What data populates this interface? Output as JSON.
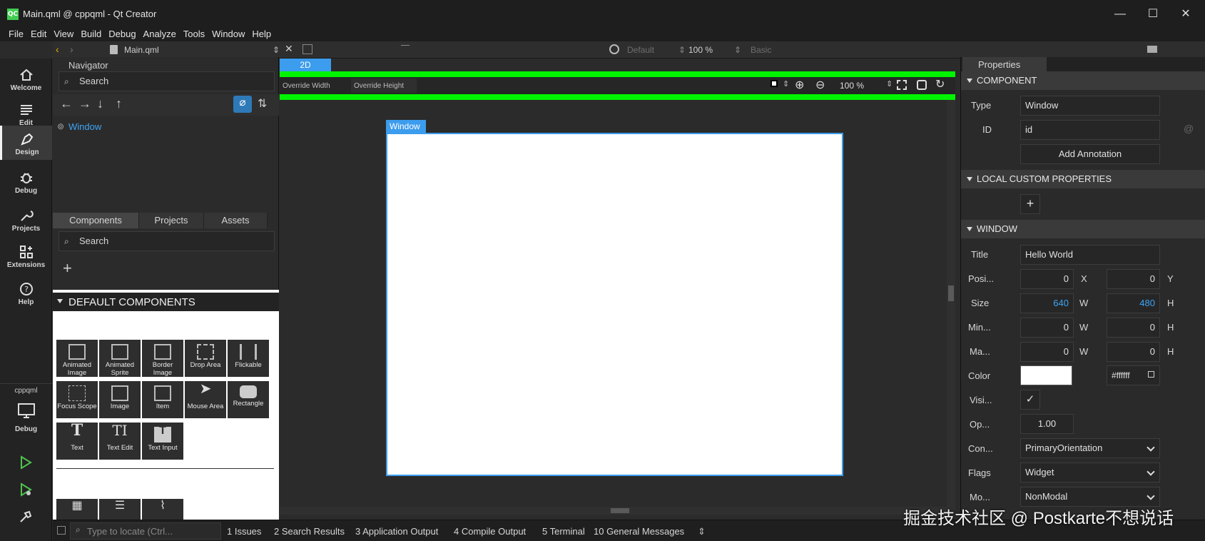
{
  "window": {
    "title": "Main.qml @ cppqml - Qt Creator",
    "logo": "QC"
  },
  "menu": [
    "File",
    "Edit",
    "View",
    "Build",
    "Debug",
    "Analyze",
    "Tools",
    "Window",
    "Help"
  ],
  "toolbar": {
    "file": "Main.qml",
    "state": "Default",
    "zoom": "100 %",
    "style": "Basic"
  },
  "modes": [
    {
      "label": "Welcome",
      "icon": "home-icon"
    },
    {
      "label": "Edit",
      "icon": "edit-icon"
    },
    {
      "label": "Design",
      "icon": "pen-icon"
    },
    {
      "label": "Debug",
      "icon": "bug-icon"
    },
    {
      "label": "Projects",
      "icon": "wrench-icon"
    },
    {
      "label": "Extensions",
      "icon": "extensions-icon"
    },
    {
      "label": "Help",
      "icon": "help-icon"
    }
  ],
  "kit": {
    "project": "cppqml",
    "config": "Debug"
  },
  "navigator": {
    "title": "Navigator",
    "search": "Search",
    "root": "Window"
  },
  "components": {
    "tabs": [
      "Components",
      "Projects",
      "Assets"
    ],
    "search": "Search",
    "section": "DEFAULT COMPONENTS",
    "items": [
      [
        "Animated",
        "Image"
      ],
      [
        "Animated",
        "Sprite"
      ],
      [
        "Border",
        "Image"
      ],
      [
        "Drop Area"
      ],
      [
        "Flickable"
      ],
      [
        "Focus Scope"
      ],
      [
        "Image"
      ],
      [
        "Item"
      ],
      [
        "Mouse Area"
      ],
      [
        "Rectangle"
      ],
      [
        "Text"
      ],
      [
        "Text Edit"
      ],
      [
        "Text Input"
      ]
    ]
  },
  "canvas": {
    "tab": "2D",
    "override_width": "Override Width",
    "override_height": "Override Height",
    "zoom": "100 %",
    "window_label": "Window"
  },
  "properties": {
    "tab": "Properties",
    "component_header": "COMPONENT",
    "type_label": "Type",
    "type_value": "Window",
    "id_label": "ID",
    "id_value": "id",
    "add_annotation": "Add Annotation",
    "custom_header": "LOCAL CUSTOM PROPERTIES",
    "window_header": "WINDOW",
    "title_label": "Title",
    "title_value": "Hello World",
    "pos_label": "Posi...",
    "pos_x": "0",
    "pos_y": "0",
    "size_label": "Size",
    "size_w": "640",
    "size_h": "480",
    "min_label": "Min...",
    "min_w": "0",
    "min_h": "0",
    "max_label": "Ma...",
    "max_w": "0",
    "max_h": "0",
    "color_label": "Color",
    "color_value": "#ffffff",
    "visible_label": "Visi...",
    "opacity_label": "Op...",
    "opacity_value": "1.00",
    "content_label": "Con...",
    "content_value": "PrimaryOrientation",
    "flags_label": "Flags",
    "flags_value": "Widget",
    "modality_label": "Mo...",
    "modality_value": "NonModal",
    "x": "X",
    "y": "Y",
    "w": "W",
    "h": "H"
  },
  "statusbar": {
    "locate": "Type to locate (Ctrl...",
    "panes": [
      "1  Issues",
      "2  Search Results",
      "3  Application Output",
      "4  Compile Output",
      "5  Terminal",
      "10 General Messages"
    ]
  },
  "watermark": "掘金技术社区 @ Postkarte不想说话"
}
